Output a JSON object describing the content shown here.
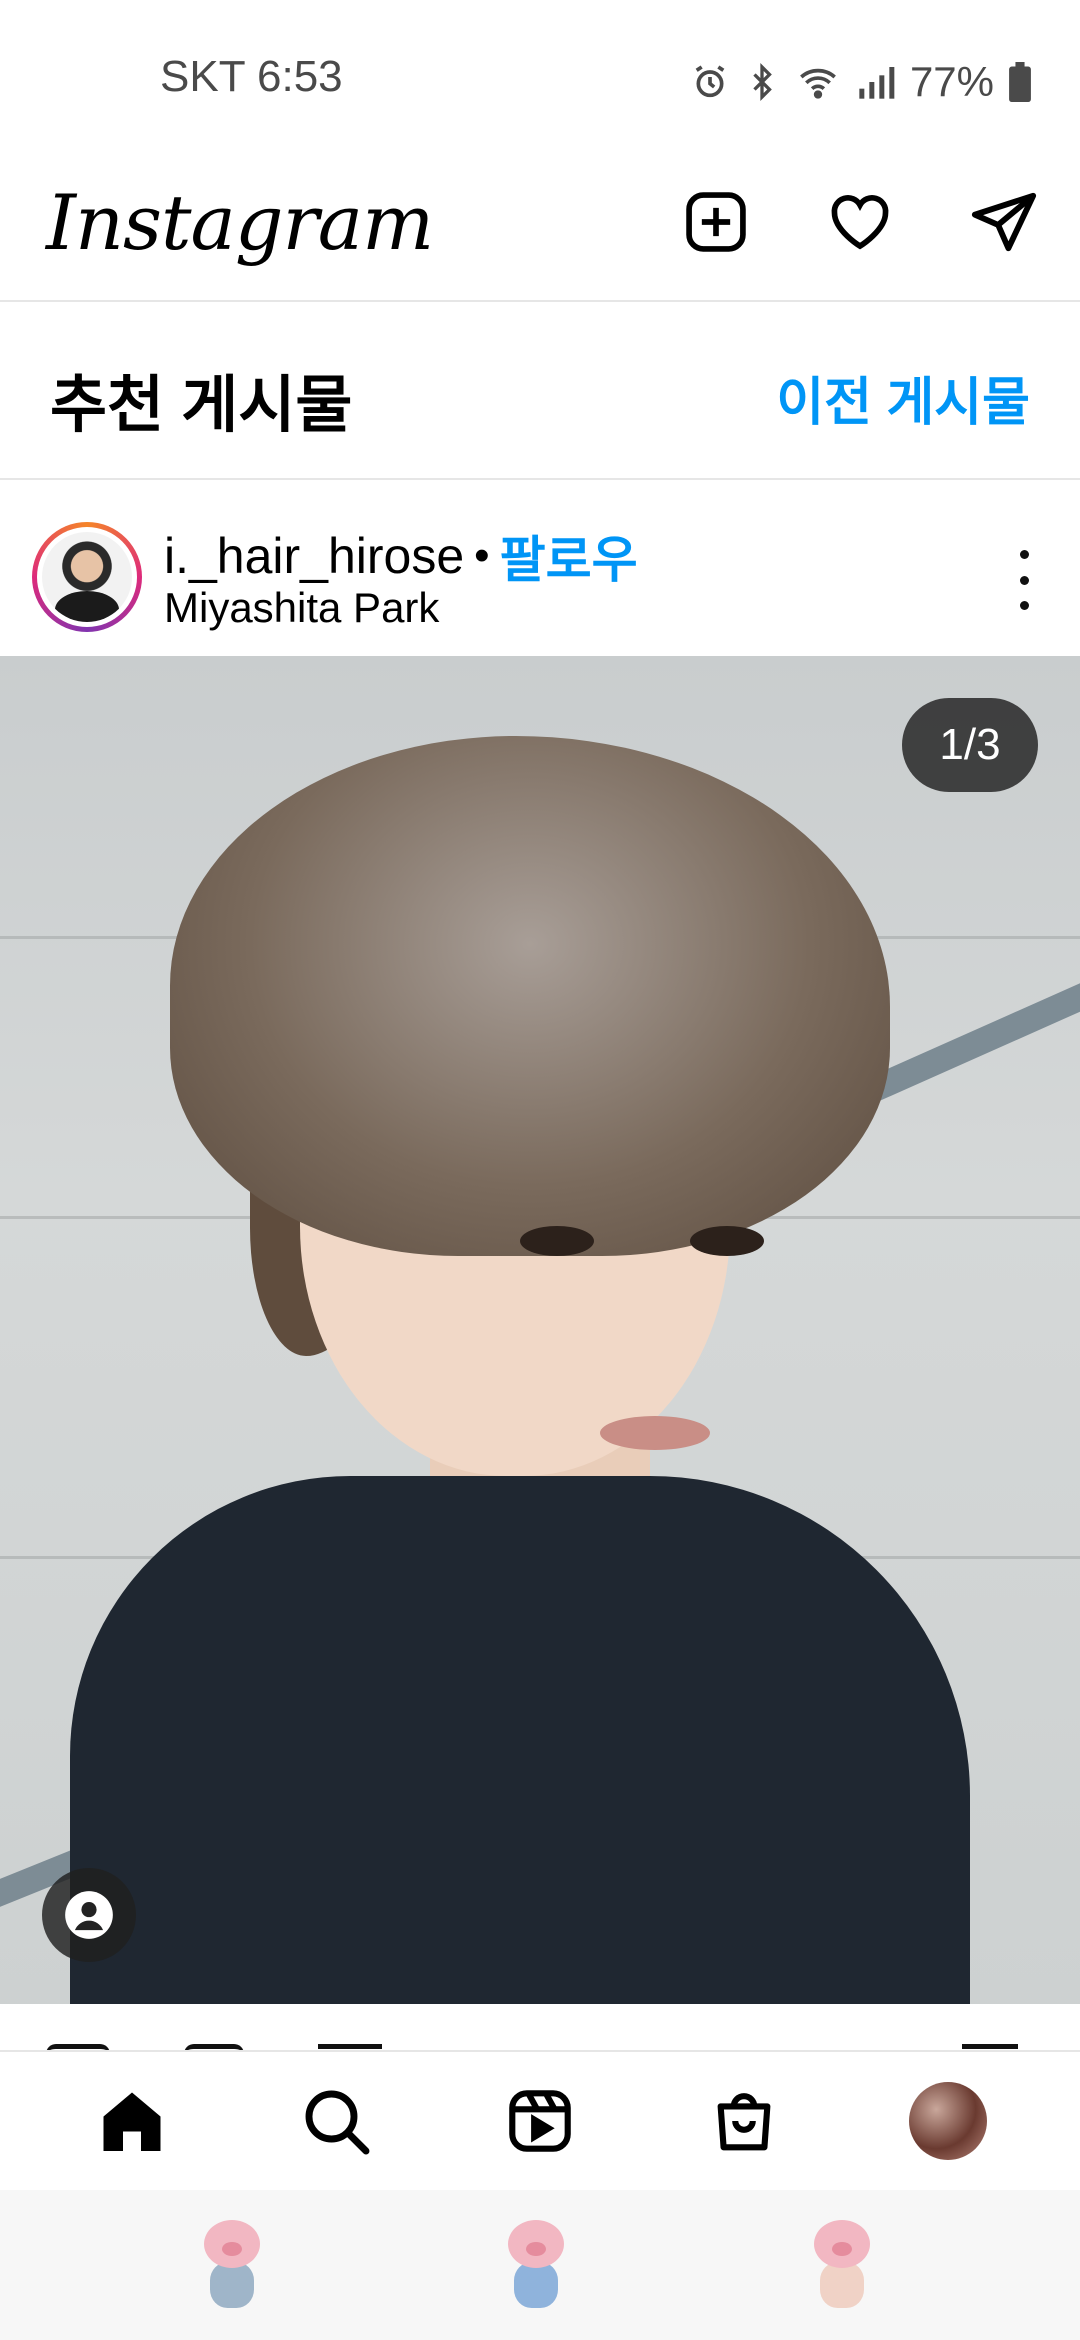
{
  "status_bar": {
    "carrier_time": "SKT 6:53",
    "battery_percent": "77%",
    "icons": [
      "alarm-icon",
      "bluetooth-icon",
      "wifi-icon",
      "signal-icon",
      "battery-icon"
    ]
  },
  "app_bar": {
    "logo": "Instagram",
    "icons": [
      "new-post-icon",
      "heart-icon",
      "direct-message-icon"
    ]
  },
  "suggested": {
    "title": "추천 게시물",
    "previous_link": "이전 게시물"
  },
  "post": {
    "username": "i._hair_hirose",
    "separator": "•",
    "follow_label": "팔로우",
    "location": "Miyashita Park",
    "image_counter": "1/3"
  },
  "bottom_nav": {
    "items": [
      "home-icon",
      "search-icon",
      "reels-icon",
      "shop-icon",
      "profile-avatar"
    ]
  },
  "colors": {
    "accent_blue": "#0095f6",
    "text": "#000000",
    "divider": "#e6e6e6"
  }
}
